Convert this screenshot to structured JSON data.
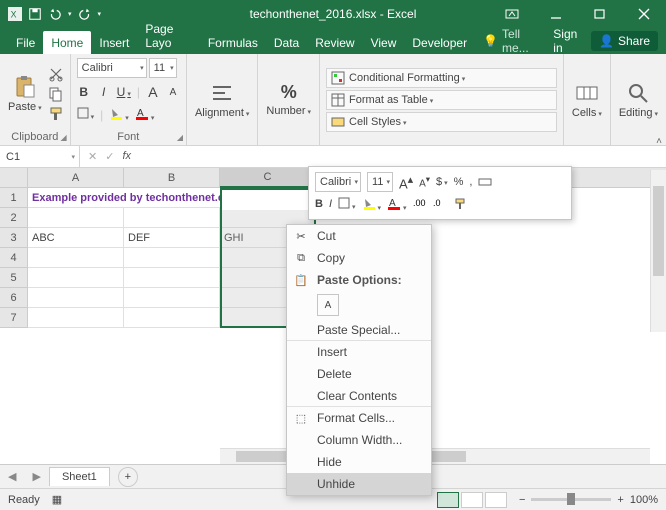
{
  "titlebar": {
    "title": "techonthenet_2016.xlsx - Excel"
  },
  "tabs": {
    "file": "File",
    "home": "Home",
    "insert": "Insert",
    "pagelayout": "Page Layo",
    "formulas": "Formulas",
    "data": "Data",
    "review": "Review",
    "view": "View",
    "developer": "Developer",
    "tellme": "Tell me...",
    "signin": "Sign in",
    "share": "Share"
  },
  "ribbon": {
    "clipboard": {
      "label": "Clipboard",
      "paste": "Paste"
    },
    "font": {
      "label": "Font",
      "name": "Calibri",
      "size": "11",
      "bold": "B",
      "italic": "I",
      "underline": "U"
    },
    "alignment": {
      "label": "Alignment"
    },
    "number": {
      "label": "Number",
      "pct": "%"
    },
    "styles": {
      "cond": "Conditional Formatting",
      "table": "Format as Table",
      "cell": "Cell Styles"
    },
    "cells": {
      "label": "Cells"
    },
    "editing": {
      "label": "Editing"
    }
  },
  "fbar": {
    "namebox": "C1",
    "fx": "fx"
  },
  "grid": {
    "cols": [
      "A",
      "B",
      "C"
    ],
    "rows": [
      "1",
      "2",
      "3",
      "4",
      "5",
      "6",
      "7"
    ],
    "row1text": "Example provided by techonthenet.com",
    "a3": "ABC",
    "b3": "DEF",
    "c3": "GHI"
  },
  "sheettabs": {
    "sheet1": "Sheet1",
    "plus": "+"
  },
  "status": {
    "ready": "Ready",
    "zoom": "100%",
    "minus": "−",
    "plus": "+"
  },
  "minitb": {
    "name": "Calibri",
    "size": "11",
    "bold": "B",
    "italic": "I",
    "dollar": "$",
    "pct": "%",
    "comma": ","
  },
  "ctx": {
    "cut": "Cut",
    "copy": "Copy",
    "pasteopts": "Paste Options:",
    "pobtn": "A",
    "pastespecial": "Paste Special...",
    "insert": "Insert",
    "delete": "Delete",
    "clear": "Clear Contents",
    "format": "Format Cells...",
    "colwidth": "Column Width...",
    "hide": "Hide",
    "unhide": "Unhide"
  }
}
